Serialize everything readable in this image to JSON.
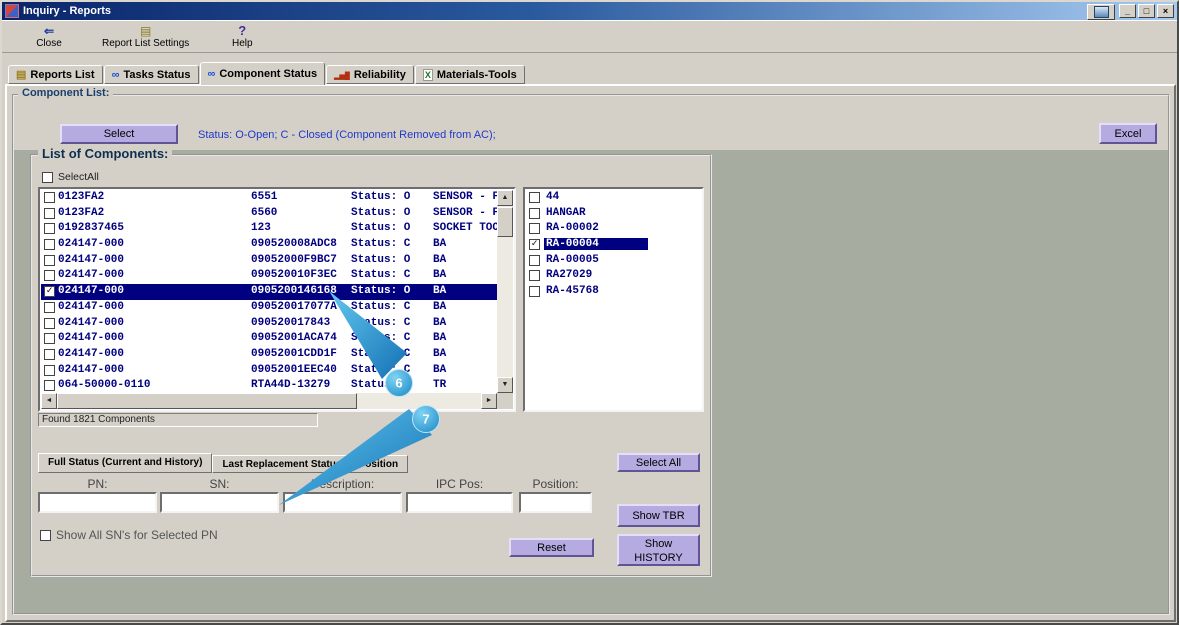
{
  "window": {
    "title": "Inquiry - Reports",
    "controls": {
      "minimize": "_",
      "maximize": "□",
      "close": "×"
    }
  },
  "colors": {
    "window-bg": "#d4d0c8",
    "panel-green": "#a6aca0",
    "button-accent": "#b5abe1",
    "selection": "#000080",
    "list-text": "#00007f",
    "legend-blue": "#2038c8",
    "title-start": "#0a246a",
    "title-end": "#a6caf0"
  },
  "toolbar": {
    "buttons": [
      {
        "name": "close-button",
        "label": "Close",
        "icon": "exit-icon"
      },
      {
        "name": "report-list-settings-button",
        "label": "Report List Settings",
        "icon": "report-list-icon"
      },
      {
        "name": "help-button",
        "label": "Help",
        "icon": "help-icon"
      }
    ]
  },
  "tabs": [
    {
      "name": "tab-reports-list",
      "label": "Reports List",
      "icon": "reports-icon",
      "active": false
    },
    {
      "name": "tab-tasks-status",
      "label": "Tasks Status",
      "icon": "tasks-icon",
      "active": false
    },
    {
      "name": "tab-component-status",
      "label": "Component Status",
      "icon": "component-icon",
      "active": true
    },
    {
      "name": "tab-reliability",
      "label": "Reliability",
      "icon": "reliability-icon",
      "active": false
    },
    {
      "name": "tab-materials-tools",
      "label": "Materials-Tools",
      "icon": "materials-icon",
      "active": false
    }
  ],
  "component_list": {
    "group_label": "Component List:",
    "select_button": "Select",
    "status_legend": "Status: O-Open; C - Closed (Component Removed from AC);",
    "excel_button": "Excel",
    "list_group_label": "List of Components:",
    "select_all_checkbox": "SelectAll",
    "found_text": "Found 1821 Components",
    "rows": [
      {
        "pn": "0123FA2",
        "sn": "6551",
        "status": "Status: O",
        "desc": "SENSOR - F",
        "checked": false,
        "selected": false
      },
      {
        "pn": "0123FA2",
        "sn": "6560",
        "status": "Status: O",
        "desc": "SENSOR - F",
        "checked": false,
        "selected": false
      },
      {
        "pn": "0192837465",
        "sn": "123",
        "status": "Status: O",
        "desc": "SOCKET TOO",
        "checked": false,
        "selected": false
      },
      {
        "pn": "024147-000",
        "sn": "090520008ADC8",
        "status": "Status: C",
        "desc": "BA",
        "checked": false,
        "selected": false
      },
      {
        "pn": "024147-000",
        "sn": "09052000F9BC7",
        "status": "Status: O",
        "desc": "BA",
        "checked": false,
        "selected": false
      },
      {
        "pn": "024147-000",
        "sn": "090520010F3EC",
        "status": "Status: C",
        "desc": "BA",
        "checked": false,
        "selected": false
      },
      {
        "pn": "024147-000",
        "sn": "0905200146168",
        "status": "Status: O",
        "desc": "BA",
        "checked": true,
        "selected": true
      },
      {
        "pn": "024147-000",
        "sn": "090520017077A",
        "status": "Status: C",
        "desc": "BA",
        "checked": false,
        "selected": false
      },
      {
        "pn": "024147-000",
        "sn": "090520017843",
        "status": "Status: C",
        "desc": "BA",
        "checked": false,
        "selected": false
      },
      {
        "pn": "024147-000",
        "sn": "09052001ACA74",
        "status": "Status: C",
        "desc": "BA",
        "checked": false,
        "selected": false
      },
      {
        "pn": "024147-000",
        "sn": "09052001CDD1F",
        "status": "Status: C",
        "desc": "BA",
        "checked": false,
        "selected": false
      },
      {
        "pn": "024147-000",
        "sn": "09052001EEC40",
        "status": "Status: C",
        "desc": "BA",
        "checked": false,
        "selected": false
      },
      {
        "pn": "064-50000-0110",
        "sn": "RTA44D-13279",
        "status": "Status: O",
        "desc": "TR",
        "checked": false,
        "selected": false
      }
    ],
    "aircraft": [
      {
        "label": "44",
        "checked": false,
        "selected": false
      },
      {
        "label": "HANGAR",
        "checked": false,
        "selected": false
      },
      {
        "label": "RA-00002",
        "checked": false,
        "selected": false
      },
      {
        "label": "RA-00004",
        "checked": true,
        "selected": true
      },
      {
        "label": "RA-00005",
        "checked": false,
        "selected": false
      },
      {
        "label": "RA27029",
        "checked": false,
        "selected": false
      },
      {
        "label": "RA-45768",
        "checked": false,
        "selected": false
      }
    ]
  },
  "filter": {
    "tabs": [
      "Full Status (Current and History)",
      "Last Replacement Status by Position"
    ],
    "fields": [
      {
        "key": "pn",
        "label": "PN:"
      },
      {
        "key": "sn",
        "label": "SN:"
      },
      {
        "key": "desc",
        "label": "Description:"
      },
      {
        "key": "ipc",
        "label": "IPC Pos:"
      },
      {
        "key": "pos",
        "label": "Position:"
      }
    ],
    "show_all_checkbox": "Show All SN's for Selected PN",
    "reset_button": "Reset",
    "select_all_button": "Select All",
    "show_tbr_button": "Show TBR",
    "show_history_button": "Show HISTORY"
  },
  "annotations": [
    {
      "number": "6"
    },
    {
      "number": "7"
    }
  ]
}
